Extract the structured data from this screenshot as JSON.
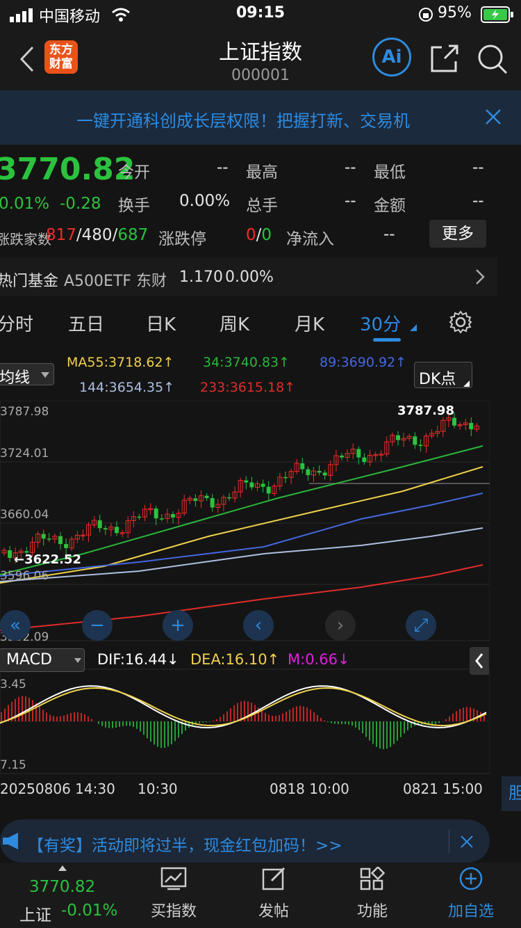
{
  "status": {
    "carrier": "中国移动",
    "time": "09:15",
    "battery": "95%"
  },
  "nav": {
    "title": "上证指数",
    "code": "000001",
    "logo_top": "东方",
    "logo_bottom": "财富",
    "ai": "Ai"
  },
  "banner": {
    "text": "一键开通科创成长层权限！把握打新、交易机"
  },
  "quote": {
    "price": "3770.82",
    "pct": "0.01%",
    "chg": "-0.28",
    "open_label": "今开",
    "open": "--",
    "high_label": "最高",
    "high": "--",
    "low_label": "最低",
    "low": "--",
    "turnover_label": "换手",
    "turnover": "0.00%",
    "volume_label": "总手",
    "volume": "--",
    "amount_label": "金额",
    "amount": "--",
    "breadth_label": "涨跌家数",
    "up": "817",
    "sep1": "/",
    "flat": "480",
    "sep2": "/",
    "down": "687",
    "limit_label": "涨跌停",
    "limit_up": "0",
    "limit_sep": "/",
    "limit_down": "0",
    "netflow_label": "净流入",
    "netflow": "--",
    "more": "更多"
  },
  "fund": {
    "label": "热门基金",
    "name": "A500ETF 东财",
    "price": "1.170",
    "pct": "0.00%"
  },
  "tabs": [
    "分时",
    "五日",
    "日K",
    "周K",
    "月K",
    "30分"
  ],
  "ma": {
    "selector": "均线",
    "ma55": "MA55:3718.62↑",
    "ma34": "34:3740.83↑",
    "ma89": "89:3690.92↑",
    "ma144": "144:3654.35↑",
    "ma233": "233:3615.18↑",
    "dk": "DK点"
  },
  "chart": {
    "y_labels": [
      "3787.98",
      "3724.01",
      "3660.04",
      "3596.06",
      "3532.09"
    ],
    "max_label": "3787.98",
    "min_label": "←3622.52"
  },
  "macd": {
    "selector": "MACD",
    "dif": "DIF:16.44↓",
    "dea": "DEA:16.10↑",
    "m": "M:0.66↓",
    "y_top": "3.45",
    "y_bottom": "7.15"
  },
  "x_labels": [
    "20250806 14:30",
    "10:30",
    "0818 10:00",
    "0821 15:00"
  ],
  "ad": {
    "text": "【有奖】活动即将过半，现金红包加码！>>"
  },
  "bottom": {
    "price": "3770.82",
    "name": "上证",
    "pct": "-0.01%",
    "buy": "买指数",
    "post": "发帖",
    "func": "功能",
    "watch": "加自选"
  },
  "colors": {
    "up": "#ef2b2b",
    "down": "#2bc23e",
    "accent": "#2e8bdf"
  }
}
